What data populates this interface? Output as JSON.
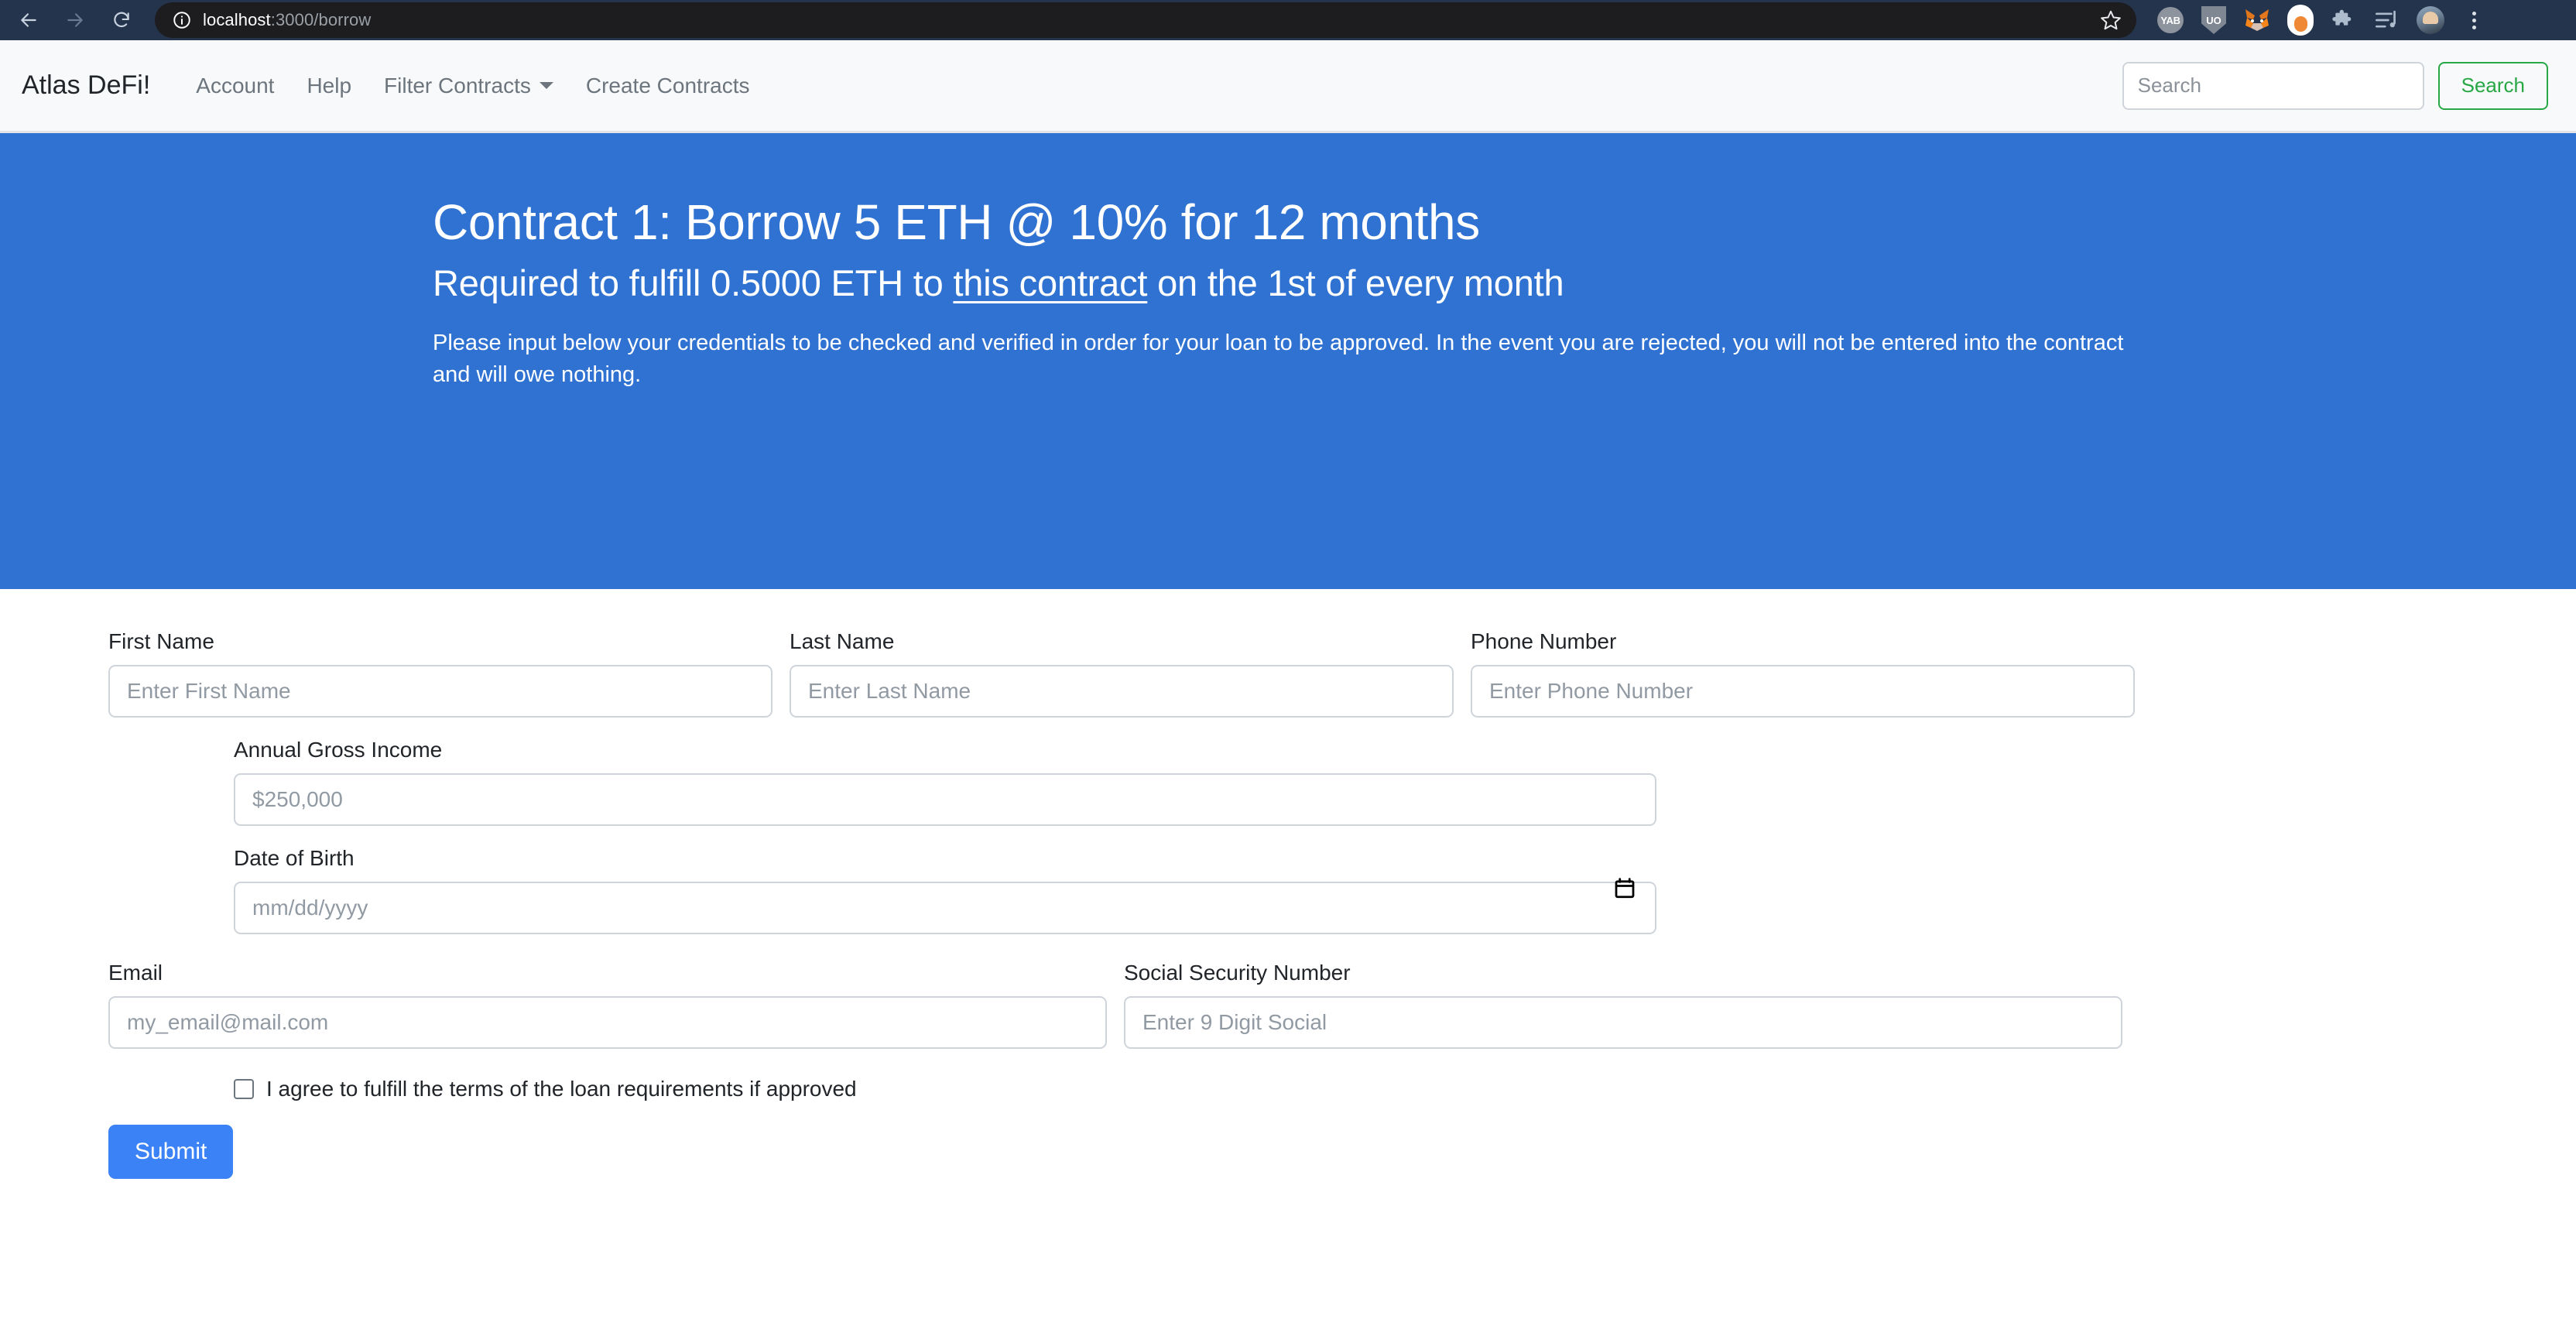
{
  "browser": {
    "back_icon": "back-arrow-icon",
    "forward_icon": "forward-arrow-icon",
    "reload_icon": "reload-icon",
    "site_info_icon": "site-info-icon",
    "url_host": "localhost",
    "url_path": ":3000/borrow",
    "bookmark_icon": "star-icon",
    "extensions": [
      {
        "name": "yab-extension-icon",
        "label": "YAB"
      },
      {
        "name": "uo-shield-extension-icon",
        "label": "UO"
      },
      {
        "name": "metamask-extension-icon",
        "label": ""
      },
      {
        "name": "toggle-extension-icon",
        "label": ""
      },
      {
        "name": "extensions-puzzle-icon",
        "label": ""
      },
      {
        "name": "media-playlist-icon",
        "label": ""
      }
    ],
    "profile_icon": "profile-avatar-icon",
    "menu_icon": "three-dot-menu-icon"
  },
  "navbar": {
    "brand": "Atlas DeFi!",
    "links": [
      {
        "label": "Account",
        "name": "nav-link-account",
        "dropdown": false
      },
      {
        "label": "Help",
        "name": "nav-link-help",
        "dropdown": false
      },
      {
        "label": "Filter Contracts",
        "name": "nav-link-filter-contracts",
        "dropdown": true
      },
      {
        "label": "Create Contracts",
        "name": "nav-link-create-contracts",
        "dropdown": false
      }
    ],
    "search_placeholder": "Search",
    "search_value": "",
    "search_button": "Search",
    "search_button_color": "#28a745"
  },
  "hero": {
    "background_color": "#2f72d2",
    "title": "Contract 1: Borrow 5 ETH @ 10% for 12 months",
    "subtitle_before": "Required to fulfill 0.5000 ETH to ",
    "subtitle_link": "this contract",
    "subtitle_after": " on the 1st of every month",
    "paragraph": "Please input below your credentials to be checked and verified in order for your loan to be approved. In the event you are rejected, you will not be entered into the contract and will owe nothing."
  },
  "form": {
    "first_name": {
      "label": "First Name",
      "placeholder": "Enter First Name",
      "value": ""
    },
    "last_name": {
      "label": "Last Name",
      "placeholder": "Enter Last Name",
      "value": ""
    },
    "phone_number": {
      "label": "Phone Number",
      "placeholder": "Enter Phone Number",
      "value": ""
    },
    "annual_gross_income": {
      "label": "Annual Gross Income",
      "placeholder": "$250,000",
      "value": ""
    },
    "date_of_birth": {
      "label": "Date of Birth",
      "placeholder": "mm/dd/yyyy",
      "value": "",
      "picker_icon": "calendar-icon"
    },
    "email": {
      "label": "Email",
      "placeholder": "my_email@mail.com",
      "value": ""
    },
    "ssn": {
      "label": "Social Security Number",
      "placeholder": "Enter 9 Digit Social",
      "value": ""
    },
    "agree": {
      "label": "I agree to fulfill the terms of the loan requirements if approved",
      "checked": false
    },
    "submit_label": "Submit",
    "submit_color": "#3b82f6"
  }
}
